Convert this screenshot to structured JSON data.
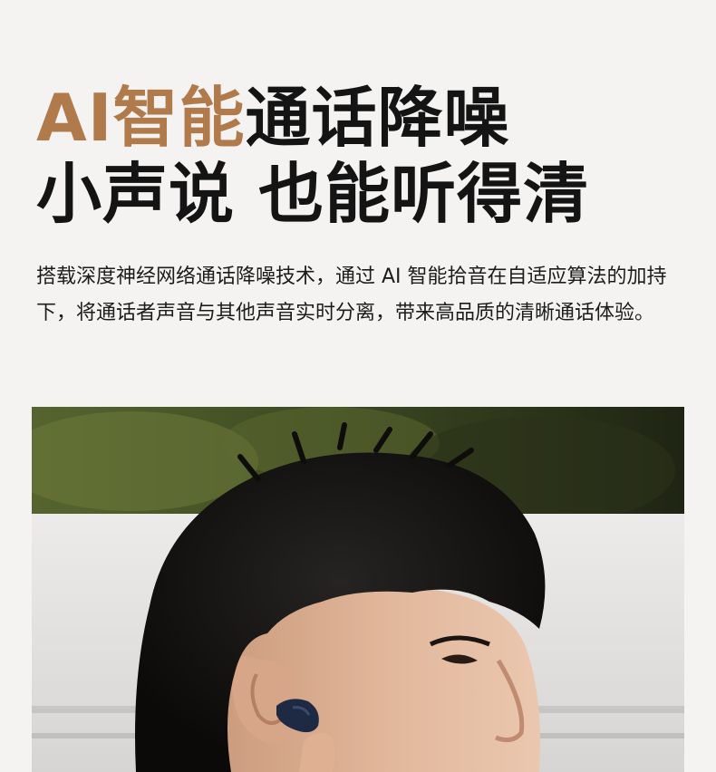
{
  "headline": {
    "line1_accent": "AI智能",
    "line1_rest": "通话降噪",
    "line2": "小声说 也能听得清"
  },
  "description": "搭载深度神经网络通话降噪技术，通过 AI 智能拾音在自适应算法的加持下，将通话者声音与其他声音实时分离，带来高品质的清晰通话体验。",
  "colors": {
    "accent": "#b07a4b",
    "text": "#141414",
    "background": "#f4f3f1",
    "earbud": "#1e2a44"
  },
  "photo": {
    "subject": "man-wearing-earbud"
  }
}
